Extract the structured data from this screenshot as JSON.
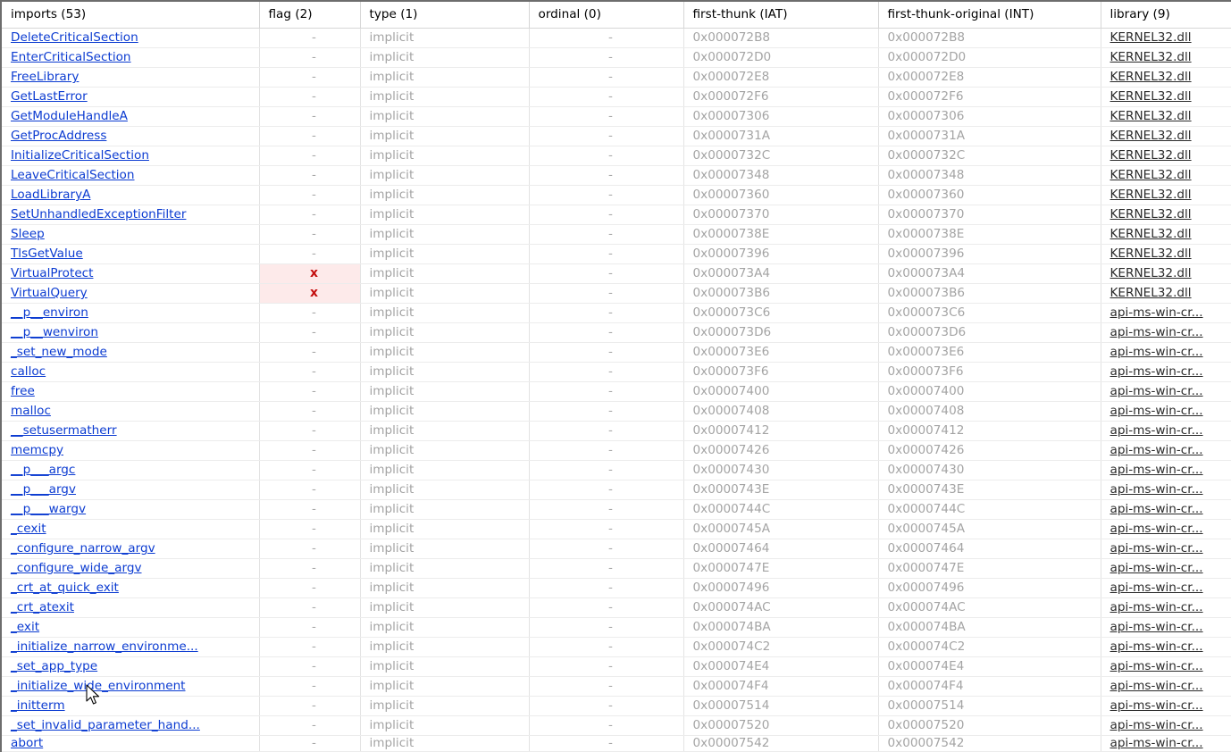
{
  "headers": {
    "imports": "imports (53)",
    "flag": "flag (2)",
    "type": "type (1)",
    "ordinal": "ordinal (0)",
    "iat": "first-thunk (IAT)",
    "int": "first-thunk-original (INT)",
    "library": "library (9)"
  },
  "flag_marker": "x",
  "cursor_icon": "mouse-pointer-icon",
  "rows": [
    {
      "name": "DeleteCriticalSection",
      "flag": "-",
      "type": "implicit",
      "ordinal": "-",
      "iat": "0x000072B8",
      "int": "0x000072B8",
      "lib": "KERNEL32.dll"
    },
    {
      "name": "EnterCriticalSection",
      "flag": "-",
      "type": "implicit",
      "ordinal": "-",
      "iat": "0x000072D0",
      "int": "0x000072D0",
      "lib": "KERNEL32.dll"
    },
    {
      "name": "FreeLibrary",
      "flag": "-",
      "type": "implicit",
      "ordinal": "-",
      "iat": "0x000072E8",
      "int": "0x000072E8",
      "lib": "KERNEL32.dll"
    },
    {
      "name": "GetLastError",
      "flag": "-",
      "type": "implicit",
      "ordinal": "-",
      "iat": "0x000072F6",
      "int": "0x000072F6",
      "lib": "KERNEL32.dll"
    },
    {
      "name": "GetModuleHandleA",
      "flag": "-",
      "type": "implicit",
      "ordinal": "-",
      "iat": "0x00007306",
      "int": "0x00007306",
      "lib": "KERNEL32.dll"
    },
    {
      "name": "GetProcAddress",
      "flag": "-",
      "type": "implicit",
      "ordinal": "-",
      "iat": "0x0000731A",
      "int": "0x0000731A",
      "lib": "KERNEL32.dll"
    },
    {
      "name": "InitializeCriticalSection",
      "flag": "-",
      "type": "implicit",
      "ordinal": "-",
      "iat": "0x0000732C",
      "int": "0x0000732C",
      "lib": "KERNEL32.dll"
    },
    {
      "name": "LeaveCriticalSection",
      "flag": "-",
      "type": "implicit",
      "ordinal": "-",
      "iat": "0x00007348",
      "int": "0x00007348",
      "lib": "KERNEL32.dll"
    },
    {
      "name": "LoadLibraryA",
      "flag": "-",
      "type": "implicit",
      "ordinal": "-",
      "iat": "0x00007360",
      "int": "0x00007360",
      "lib": "KERNEL32.dll"
    },
    {
      "name": "SetUnhandledExceptionFilter",
      "flag": "-",
      "type": "implicit",
      "ordinal": "-",
      "iat": "0x00007370",
      "int": "0x00007370",
      "lib": "KERNEL32.dll"
    },
    {
      "name": "Sleep",
      "flag": "-",
      "type": "implicit",
      "ordinal": "-",
      "iat": "0x0000738E",
      "int": "0x0000738E",
      "lib": "KERNEL32.dll"
    },
    {
      "name": "TlsGetValue",
      "flag": "-",
      "type": "implicit",
      "ordinal": "-",
      "iat": "0x00007396",
      "int": "0x00007396",
      "lib": "KERNEL32.dll"
    },
    {
      "name": "VirtualProtect",
      "flag": "x",
      "type": "implicit",
      "ordinal": "-",
      "iat": "0x000073A4",
      "int": "0x000073A4",
      "lib": "KERNEL32.dll"
    },
    {
      "name": "VirtualQuery",
      "flag": "x",
      "type": "implicit",
      "ordinal": "-",
      "iat": "0x000073B6",
      "int": "0x000073B6",
      "lib": "KERNEL32.dll"
    },
    {
      "name": "__p__environ",
      "flag": "-",
      "type": "implicit",
      "ordinal": "-",
      "iat": "0x000073C6",
      "int": "0x000073C6",
      "lib": "api-ms-win-cr..."
    },
    {
      "name": "__p__wenviron",
      "flag": "-",
      "type": "implicit",
      "ordinal": "-",
      "iat": "0x000073D6",
      "int": "0x000073D6",
      "lib": "api-ms-win-cr..."
    },
    {
      "name": "_set_new_mode",
      "flag": "-",
      "type": "implicit",
      "ordinal": "-",
      "iat": "0x000073E6",
      "int": "0x000073E6",
      "lib": "api-ms-win-cr..."
    },
    {
      "name": "calloc",
      "flag": "-",
      "type": "implicit",
      "ordinal": "-",
      "iat": "0x000073F6",
      "int": "0x000073F6",
      "lib": "api-ms-win-cr..."
    },
    {
      "name": "free",
      "flag": "-",
      "type": "implicit",
      "ordinal": "-",
      "iat": "0x00007400",
      "int": "0x00007400",
      "lib": "api-ms-win-cr..."
    },
    {
      "name": "malloc",
      "flag": "-",
      "type": "implicit",
      "ordinal": "-",
      "iat": "0x00007408",
      "int": "0x00007408",
      "lib": "api-ms-win-cr..."
    },
    {
      "name": "__setusermatherr",
      "flag": "-",
      "type": "implicit",
      "ordinal": "-",
      "iat": "0x00007412",
      "int": "0x00007412",
      "lib": "api-ms-win-cr..."
    },
    {
      "name": "memcpy",
      "flag": "-",
      "type": "implicit",
      "ordinal": "-",
      "iat": "0x00007426",
      "int": "0x00007426",
      "lib": "api-ms-win-cr..."
    },
    {
      "name": "__p___argc",
      "flag": "-",
      "type": "implicit",
      "ordinal": "-",
      "iat": "0x00007430",
      "int": "0x00007430",
      "lib": "api-ms-win-cr..."
    },
    {
      "name": "__p___argv",
      "flag": "-",
      "type": "implicit",
      "ordinal": "-",
      "iat": "0x0000743E",
      "int": "0x0000743E",
      "lib": "api-ms-win-cr..."
    },
    {
      "name": "__p___wargv",
      "flag": "-",
      "type": "implicit",
      "ordinal": "-",
      "iat": "0x0000744C",
      "int": "0x0000744C",
      "lib": "api-ms-win-cr..."
    },
    {
      "name": "_cexit",
      "flag": "-",
      "type": "implicit",
      "ordinal": "-",
      "iat": "0x0000745A",
      "int": "0x0000745A",
      "lib": "api-ms-win-cr..."
    },
    {
      "name": "_configure_narrow_argv",
      "flag": "-",
      "type": "implicit",
      "ordinal": "-",
      "iat": "0x00007464",
      "int": "0x00007464",
      "lib": "api-ms-win-cr..."
    },
    {
      "name": "_configure_wide_argv",
      "flag": "-",
      "type": "implicit",
      "ordinal": "-",
      "iat": "0x0000747E",
      "int": "0x0000747E",
      "lib": "api-ms-win-cr..."
    },
    {
      "name": "_crt_at_quick_exit",
      "flag": "-",
      "type": "implicit",
      "ordinal": "-",
      "iat": "0x00007496",
      "int": "0x00007496",
      "lib": "api-ms-win-cr..."
    },
    {
      "name": "_crt_atexit",
      "flag": "-",
      "type": "implicit",
      "ordinal": "-",
      "iat": "0x000074AC",
      "int": "0x000074AC",
      "lib": "api-ms-win-cr..."
    },
    {
      "name": "_exit",
      "flag": "-",
      "type": "implicit",
      "ordinal": "-",
      "iat": "0x000074BA",
      "int": "0x000074BA",
      "lib": "api-ms-win-cr..."
    },
    {
      "name": "_initialize_narrow_environme...",
      "flag": "-",
      "type": "implicit",
      "ordinal": "-",
      "iat": "0x000074C2",
      "int": "0x000074C2",
      "lib": "api-ms-win-cr..."
    },
    {
      "name": "_set_app_type",
      "flag": "-",
      "type": "implicit",
      "ordinal": "-",
      "iat": "0x000074E4",
      "int": "0x000074E4",
      "lib": "api-ms-win-cr..."
    },
    {
      "name": "_initialize_wide_environment",
      "flag": "-",
      "type": "implicit",
      "ordinal": "-",
      "iat": "0x000074F4",
      "int": "0x000074F4",
      "lib": "api-ms-win-cr..."
    },
    {
      "name": "_initterm",
      "flag": "-",
      "type": "implicit",
      "ordinal": "-",
      "iat": "0x00007514",
      "int": "0x00007514",
      "lib": "api-ms-win-cr..."
    },
    {
      "name": "_set_invalid_parameter_hand...",
      "flag": "-",
      "type": "implicit",
      "ordinal": "-",
      "iat": "0x00007520",
      "int": "0x00007520",
      "lib": "api-ms-win-cr..."
    },
    {
      "name": "abort",
      "flag": "-",
      "type": "implicit",
      "ordinal": "-",
      "iat": "0x00007542",
      "int": "0x00007542",
      "lib": "api-ms-win-cr..."
    }
  ]
}
